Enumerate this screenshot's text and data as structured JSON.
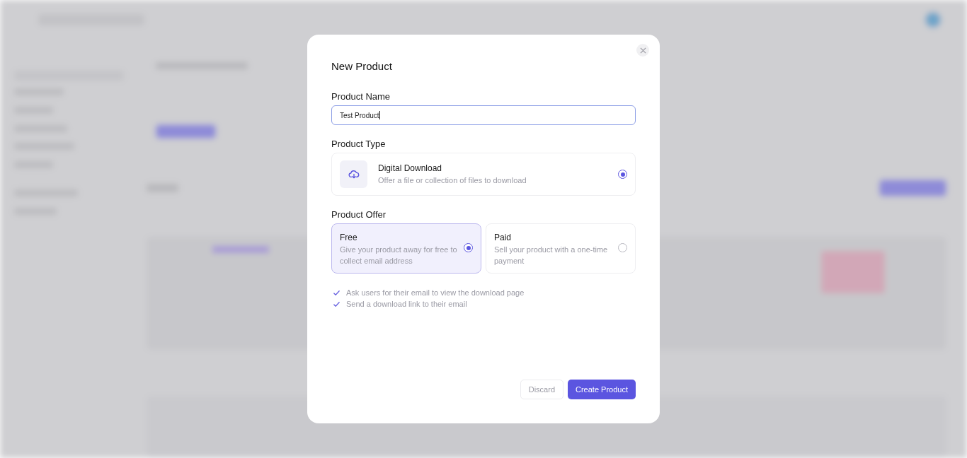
{
  "dialog": {
    "title": "New Product",
    "name_field": {
      "label": "Product Name",
      "value": "Test Product",
      "focused": true
    },
    "type_section": {
      "label": "Product Type",
      "options": [
        {
          "title": "Digital Download",
          "description": "Offer a file or collection of files to download",
          "selected": true
        }
      ]
    },
    "offer_section": {
      "label": "Product Offer",
      "options": [
        {
          "title": "Free",
          "description": "Give your product away for free to collect email address",
          "selected": true
        },
        {
          "title": "Paid",
          "description": "Sell your product with a one-time payment",
          "selected": false
        }
      ]
    },
    "features": [
      {
        "text": "Ask users for their email to view the download page",
        "checked": true
      },
      {
        "text": "Send a download link to their email",
        "checked": true
      }
    ],
    "buttons": [
      {
        "label": "Discard",
        "kind": "secondary"
      },
      {
        "label": "Create Product",
        "kind": "primary"
      }
    ]
  }
}
